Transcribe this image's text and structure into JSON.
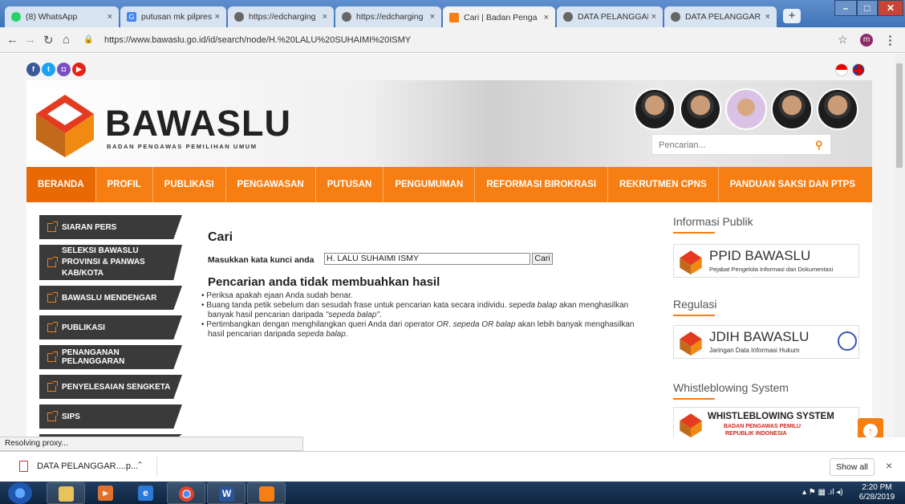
{
  "browser": {
    "tabs": [
      {
        "label": "(8) WhatsApp",
        "color": "#25d366",
        "icon": "whatsapp-icon"
      },
      {
        "label": "putusan mk pilpres",
        "color": "#4285f4",
        "icon": "google-icon"
      },
      {
        "label": "https://edcharging",
        "color": "#555555",
        "icon": "globe-icon"
      },
      {
        "label": "https://edcharging",
        "color": "#555555",
        "icon": "globe-icon"
      },
      {
        "label": "Cari | Badan Penga",
        "color": "#f77e12",
        "icon": "bawaslu-icon"
      },
      {
        "label": "DATA PELANGGAR",
        "color": "#555555",
        "icon": "globe-icon"
      },
      {
        "label": "DATA PELANGGAR",
        "color": "#555555",
        "icon": "globe-icon"
      }
    ],
    "tab_close": "×",
    "new_tab": "+",
    "url": "https://www.bawaslu.go.id/id/search/node/H.%20LALU%20SUHAIMI%20ISMY",
    "profile_initial": "m"
  },
  "site": {
    "brand": "BAWASLU",
    "brand_sub": "BADAN PENGAWAS PEMILIHAN UMUM",
    "search_placeholder": "Pencarian...",
    "nav": [
      "BERANDA",
      "PROFIL",
      "PUBLIKASI",
      "PENGAWASAN",
      "PUTUSAN",
      "PENGUMUMAN",
      "REFORMASI BIROKRASI",
      "REKRUTMEN CPNS",
      "PANDUAN SAKSI DAN PTPS"
    ],
    "accent": "#f77e12"
  },
  "sidebar": [
    "SIARAN PERS",
    "SELEKSI BAWASLU PROVINSI & PANWAS KAB/KOTA",
    "BAWASLU MENDENGAR",
    "PUBLIKASI",
    "PENANGANAN PELANGGARAN",
    "PENYELESAIAN SENGKETA",
    "SIPS"
  ],
  "main": {
    "title": "Cari",
    "label": "Masukkan kata kunci anda",
    "query": "H. LALU SUHAIMI ISMY",
    "button": "Cari",
    "no_result": "Pencarian anda tidak membuahkan hasil",
    "tip1": "Periksa apakah ejaan Anda sudah benar.",
    "tip2a": "Buang tanda petik sebelum dan sesudah frase untuk pencarian kata secara individu.",
    "tip2b": "sepeda balap",
    "tip2c": "akan menghasilkan banyak hasil pencarian daripada",
    "tip2d": "\"sepeda balap\"",
    "tip2e": ".",
    "tip3a": "Pertimbangkan dengan menghilangkan queri Anda dari operator",
    "tip3b": "OR",
    "tip3c": ".",
    "tip3d": "sepeda OR balap",
    "tip3e": "akan lebih banyak menghasilkan hasil pencarian daripada",
    "tip3f": "sepeda balap",
    "tip3g": "."
  },
  "right": {
    "h1": "Informasi Publik",
    "b1_title": "PPID BAWASLU",
    "b1_sub": "Pejabat Pengelola Informasi dan Dokumentasi",
    "h2": "Regulasi",
    "b2_title": "JDIH BAWASLU",
    "b2_sub": "Jaringan Data Informasi Hukum",
    "h3": "Whistleblowing System",
    "b3_title": "WHISTLEBLOWING SYSTEM",
    "b3_sub1": "BADAN PENGAWAS PEMILU",
    "b3_sub2": "REPUBLIK INDONESIA"
  },
  "status": "Resolving proxy...",
  "download": {
    "file": "DATA PELANGGAR....p...",
    "show_all": "Show all",
    "close": "×"
  },
  "taskbar": {
    "time": "2:20 PM",
    "date": "6/28/2019"
  }
}
